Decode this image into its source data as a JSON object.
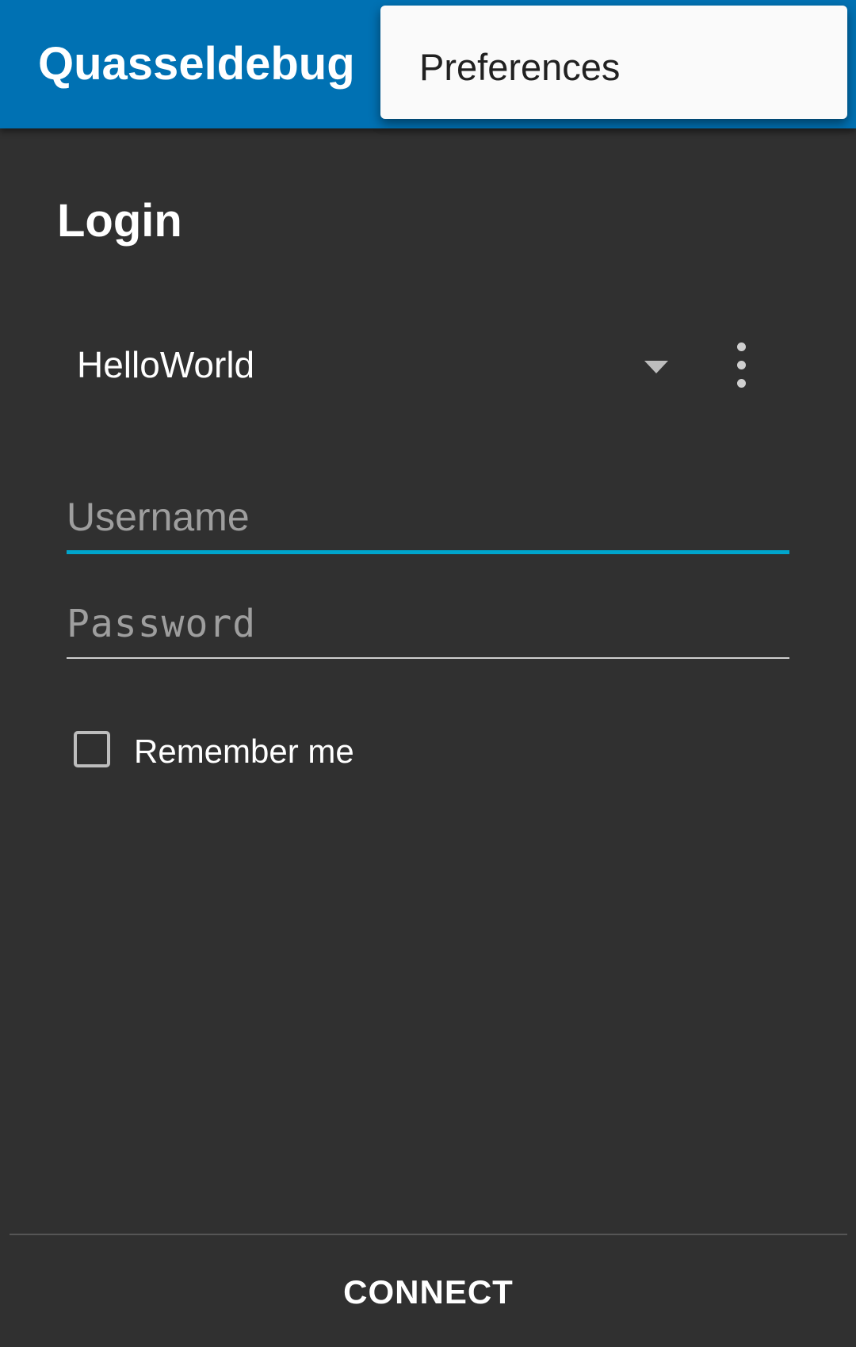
{
  "app": {
    "title": "Quasseldebug",
    "primary_color": "#0071b3",
    "background_color": "#303030",
    "accent_color": "#00a5cc"
  },
  "menu": {
    "items": [
      {
        "label": "Preferences"
      }
    ]
  },
  "login": {
    "title": "Login",
    "account": {
      "selected": "HelloWorld",
      "arrow_icon": "dropdown-arrow-icon",
      "overflow_icon": "more-vert-icon"
    },
    "username": {
      "value": "",
      "placeholder": "Username"
    },
    "password": {
      "value": "",
      "placeholder": "Password"
    },
    "remember_me": {
      "label": "Remember me",
      "checked": false
    },
    "connect_label": "CONNECT"
  }
}
